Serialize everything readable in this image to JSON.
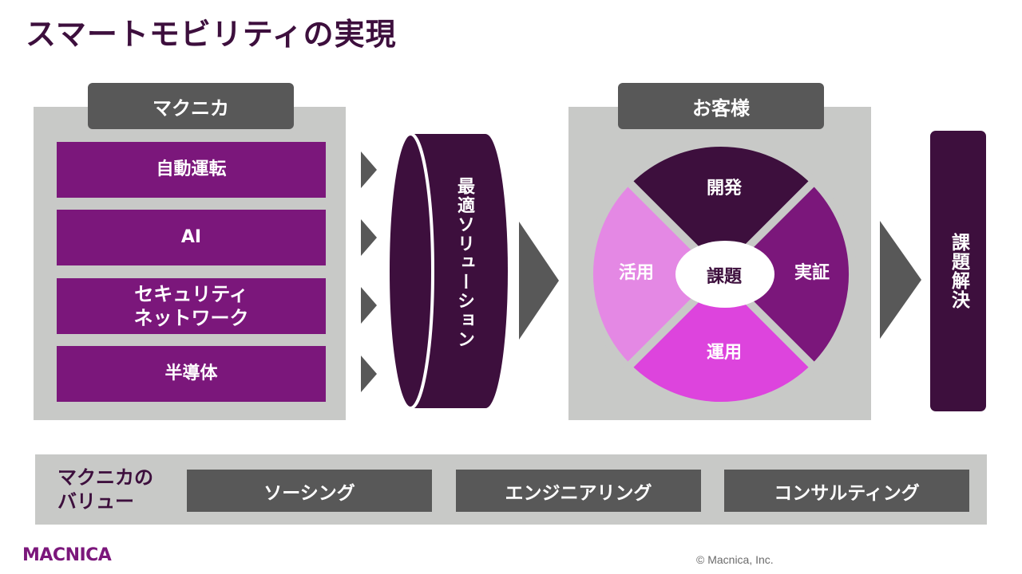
{
  "title": "スマートモビリティの実現",
  "macnica": {
    "header": "マクニカ",
    "technologies": [
      "自動運転",
      "AI",
      "セキュリティ\nネットワーク",
      "半導体"
    ]
  },
  "solution": {
    "label": "最適ソリューション"
  },
  "customer": {
    "header": "お客様",
    "cycle": {
      "center": "課題",
      "top": "開発",
      "right": "実証",
      "bottom": "運用",
      "left": "活用"
    }
  },
  "resolution": {
    "label": "課題解決"
  },
  "values": {
    "label": "マクニカの\nバリュー",
    "items": [
      "ソーシング",
      "エンジニアリング",
      "コンサルティング"
    ]
  },
  "footer": {
    "logo": "MACNICA",
    "copyright": "© Macnica, Inc."
  },
  "colors": {
    "dark_purple": "#3d0f3d",
    "purple": "#7b177b",
    "magenta": "#dd44dd",
    "pink": "#e488e4",
    "gray_panel": "#c8c9c7",
    "dark_gray": "#585858"
  }
}
